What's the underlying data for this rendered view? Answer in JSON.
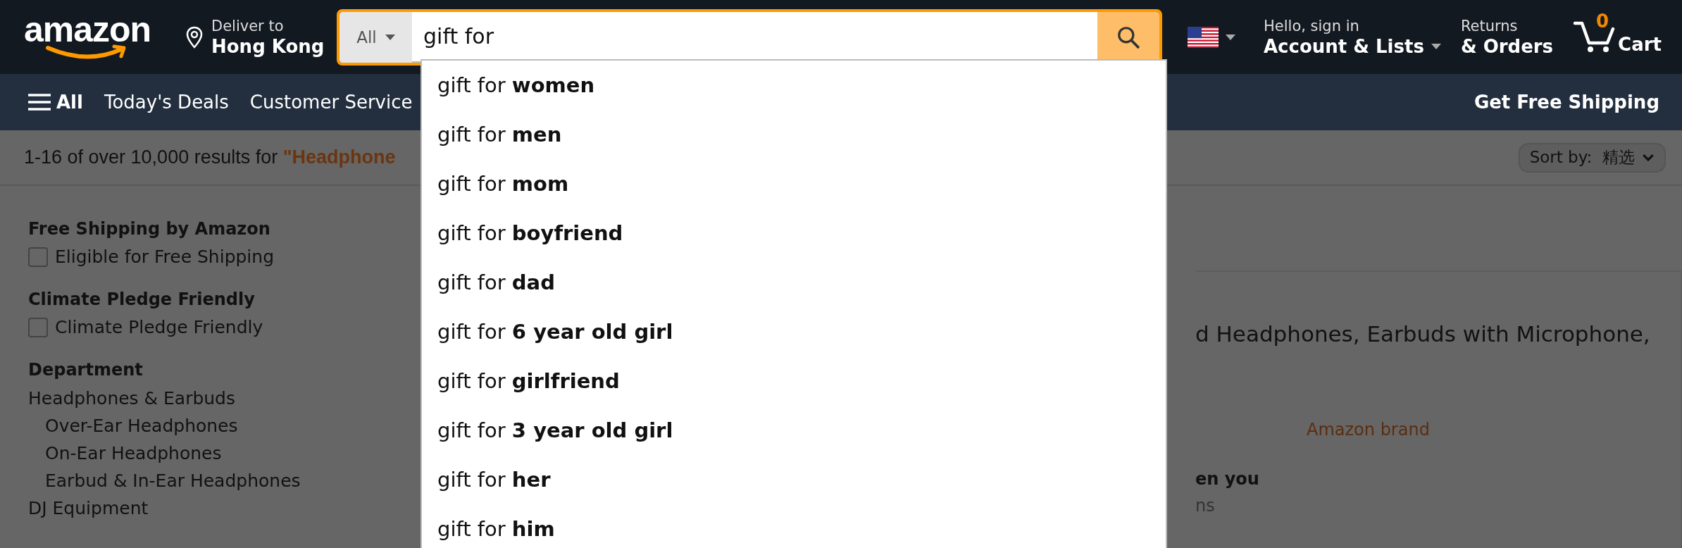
{
  "header": {
    "logo": "amazon",
    "deliver": {
      "label": "Deliver to",
      "location": "Hong Kong"
    },
    "search": {
      "category": "All",
      "value": "gift for"
    },
    "account": {
      "greeting": "Hello, sign in",
      "label": "Account & Lists"
    },
    "orders": {
      "top": "Returns",
      "label": "& Orders"
    },
    "cart": {
      "count": "0",
      "label": "Cart"
    }
  },
  "nav": {
    "all": "All",
    "items": [
      "Today's Deals",
      "Customer Service"
    ],
    "promo": "Get Free Shipping"
  },
  "results": {
    "summary": "1-16 of over 10,000 results for ",
    "query": "\"Headphone",
    "sort": {
      "label": "Sort by:",
      "value": "精选"
    }
  },
  "suggestions": [
    "gift for **women**",
    "gift for **men**",
    "gift for **mom**",
    "gift for **boyfriend**",
    "gift for **dad**",
    "gift for **6 year old girl**",
    "gift for **girlfriend**",
    "gift for **3 year old girl**",
    "gift for **her**",
    "gift for **him**"
  ],
  "filters": [
    {
      "kind": "checkbox",
      "heading": "Free Shipping by Amazon",
      "options": [
        {
          "label": "Eligible for Free Shipping",
          "checked": false
        }
      ]
    },
    {
      "kind": "checkbox",
      "heading": "Climate Pledge Friendly",
      "options": [
        {
          "label": "Climate Pledge Friendly",
          "checked": false
        }
      ]
    },
    {
      "kind": "tree",
      "heading": "Department",
      "items": [
        {
          "label": "Headphones & Earbuds",
          "children": [
            {
              "label": "Over-Ear Headphones"
            },
            {
              "label": "On-Ear Headphones"
            },
            {
              "label": "Earbud & In-Ear Headphones"
            }
          ]
        },
        {
          "label": "DJ Equipment"
        }
      ]
    }
  ],
  "product": {
    "title": "d Headphones, Earbuds with Microphone,",
    "brand": "Amazon brand",
    "line_1": "en you",
    "line_2": "ns"
  }
}
